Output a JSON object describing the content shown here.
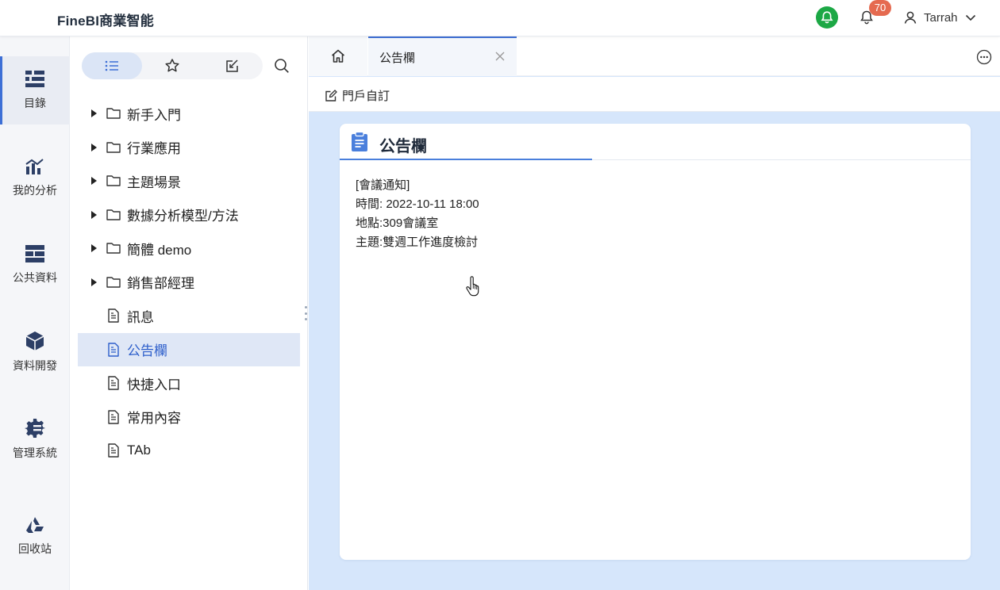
{
  "header": {
    "brand": "FineBI商業智能",
    "notification_count": "70",
    "user_name": "Tarrah",
    "colors": {
      "green_bell": "#1ca845",
      "badge": "#e56a50",
      "accent": "#3d6fd6"
    }
  },
  "leftnav": {
    "items": [
      {
        "label": "目錄",
        "icon": "directory-icon"
      },
      {
        "label": "我的分析",
        "icon": "analysis-chart-icon"
      },
      {
        "label": "公共資料",
        "icon": "public-data-icon"
      },
      {
        "label": "資料開發",
        "icon": "data-dev-cube-icon"
      },
      {
        "label": "管理系統",
        "icon": "gear-admin-icon"
      },
      {
        "label": "回收站",
        "icon": "recycle-bin-icon"
      }
    ]
  },
  "directory": {
    "tabs": [
      {
        "icon": "list-icon"
      },
      {
        "icon": "star-icon"
      },
      {
        "icon": "edit-box-icon"
      }
    ],
    "items": [
      {
        "label": "新手入門",
        "type": "folder"
      },
      {
        "label": "行業應用",
        "type": "folder"
      },
      {
        "label": "主題場景",
        "type": "folder"
      },
      {
        "label": "數據分析模型/方法",
        "type": "folder"
      },
      {
        "label": "簡體 demo",
        "type": "folder"
      },
      {
        "label": "銷售部經理",
        "type": "folder"
      },
      {
        "label": "訊息",
        "type": "file"
      },
      {
        "label": "公告欄",
        "type": "file"
      },
      {
        "label": "快捷入口",
        "type": "file"
      },
      {
        "label": "常用內容",
        "type": "file"
      },
      {
        "label": "TAb",
        "type": "file"
      }
    ]
  },
  "main": {
    "tab_label": "公告欄",
    "toolbar": {
      "customize_label": "門戶自訂"
    },
    "card": {
      "title": "公告欄",
      "lines": [
        "[會議通知]",
        "時間: 2022-10-11 18:00",
        "地點:309會議室",
        "主題:雙週工作進度檢討"
      ]
    }
  }
}
